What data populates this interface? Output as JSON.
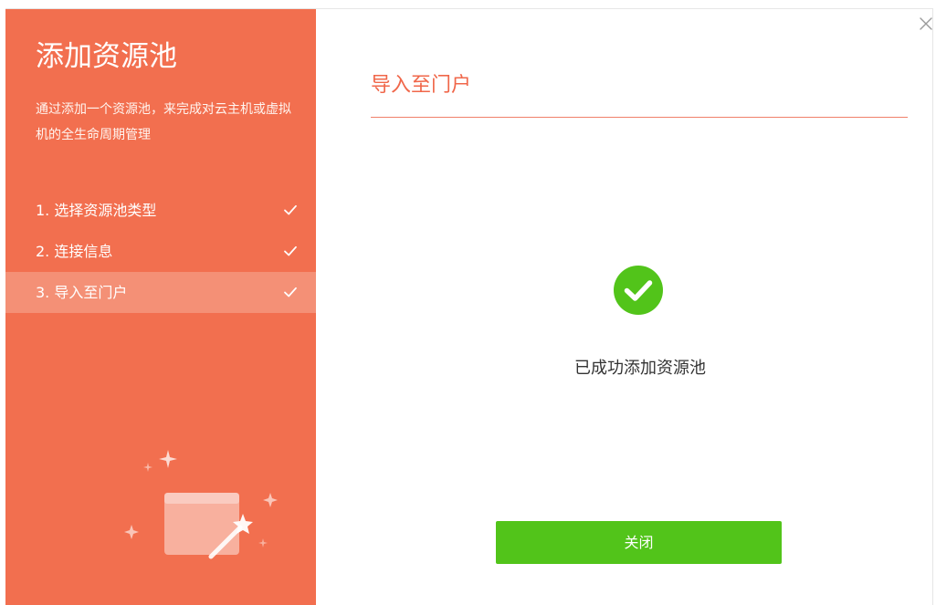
{
  "sidebar": {
    "title": "添加资源池",
    "description": "通过添加一个资源池，来完成对云主机或虚拟机的全生命周期管理",
    "steps": [
      {
        "label": "1. 选择资源池类型",
        "completed": true,
        "active": false
      },
      {
        "label": "2. 连接信息",
        "completed": true,
        "active": false
      },
      {
        "label": "3. 导入至门户",
        "completed": true,
        "active": true
      }
    ],
    "illustration_icon": "magic-wand-window-icon"
  },
  "main": {
    "title": "导入至门户",
    "status_icon": "check-circle-icon",
    "status_text": "已成功添加资源池",
    "close_button_label": "关闭"
  },
  "window": {
    "close_icon": "close-icon"
  },
  "colors": {
    "sidebar_bg": "#f26f4f",
    "active_step_bg": "#f49076",
    "accent": "#f0674a",
    "success": "#52c41a"
  }
}
